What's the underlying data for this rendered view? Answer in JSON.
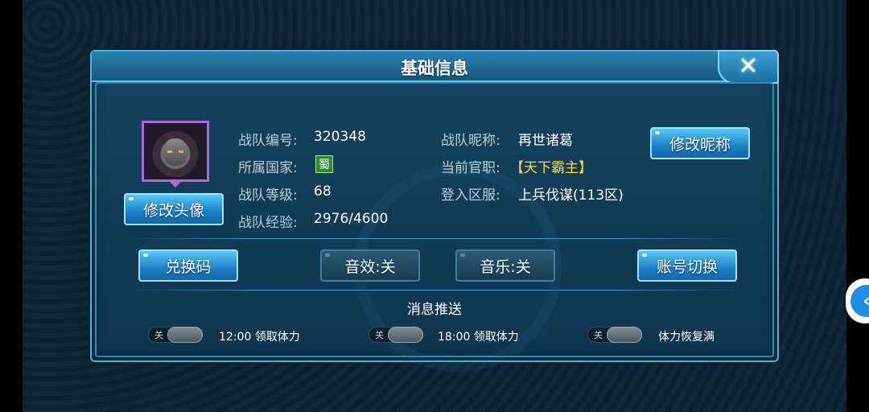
{
  "dialog": {
    "title": "基础信息",
    "close_icon": "close-icon"
  },
  "profile": {
    "team_id_label": "战队编号:",
    "team_id_value": "320348",
    "country_label": "所属国家:",
    "country_value": "蜀",
    "level_label": "战队等级:",
    "level_value": "68",
    "exp_label": "战队经验:",
    "exp_value": "2976/4600",
    "nickname_label": "战队昵称:",
    "nickname_value": "再世诸葛",
    "title_label": "当前官职:",
    "title_value": "【天下霸主】",
    "server_label": "登入区服:",
    "server_value": "上兵伐谋(113区)"
  },
  "buttons": {
    "change_avatar": "修改头像",
    "change_nickname": "修改昵称",
    "redeem_code": "兑换码",
    "sound_effects": "音效:关",
    "music": "音乐:关",
    "switch_account": "账号切换"
  },
  "push": {
    "section_title": "消息推送",
    "items": [
      {
        "state": "关",
        "label": "12:00 领取体力"
      },
      {
        "state": "关",
        "label": "18:00 领取体力"
      },
      {
        "state": "关",
        "label": "体力恢复满"
      }
    ]
  },
  "side_tab": {
    "icon": "chevron-left-icon",
    "glyph": "‹"
  },
  "colors": {
    "accent_blue": "#1d7fc6",
    "gold_text": "#ffd84a",
    "panel_bg": "#113a54",
    "border": "#4fb6d8"
  }
}
